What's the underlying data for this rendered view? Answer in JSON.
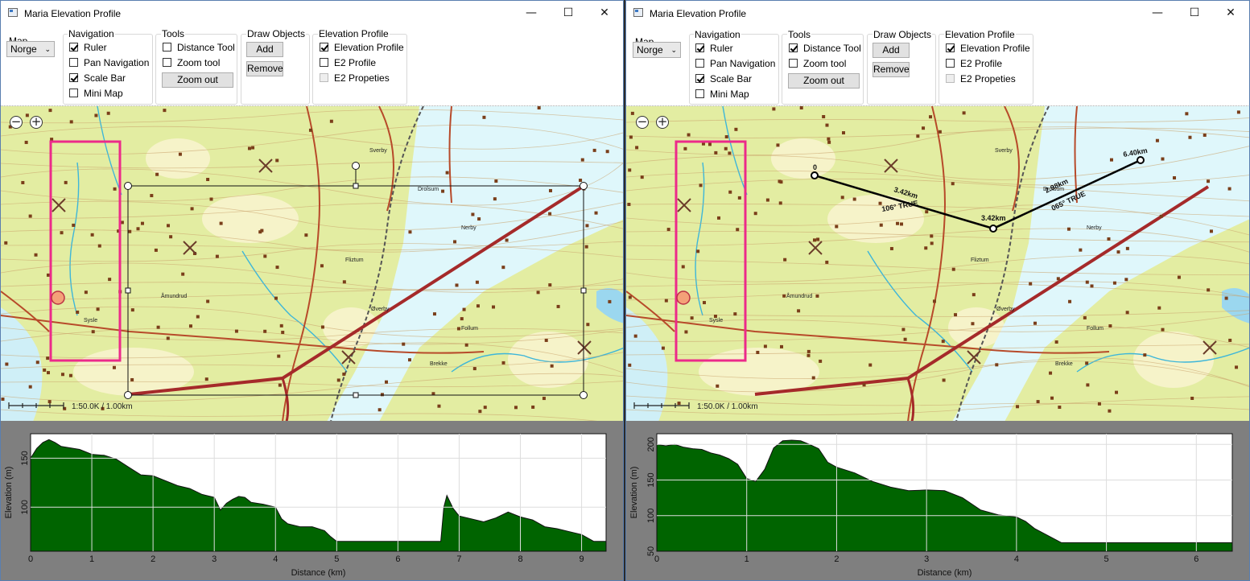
{
  "windows": [
    {
      "title": "Maria Elevation Profile",
      "controls": {
        "minimize": "—",
        "maximize": "☐",
        "close": "✕"
      },
      "toolbar": {
        "map": {
          "label": "Map",
          "selected": "Norge"
        },
        "navigation": {
          "label": "Navigation",
          "items": [
            {
              "label": "Ruler",
              "checked": true
            },
            {
              "label": "Pan Navigation",
              "checked": false
            },
            {
              "label": "Scale Bar",
              "checked": true
            },
            {
              "label": "Mini Map",
              "checked": false
            }
          ]
        },
        "tools": {
          "label": "Tools",
          "items": [
            {
              "label": "Distance Tool",
              "checked": false
            },
            {
              "label": "Zoom tool",
              "checked": false
            }
          ],
          "zoom_out": "Zoom out"
        },
        "draw": {
          "label": "Draw Objects",
          "add": "Add",
          "remove": "Remove"
        },
        "elevation": {
          "label": "Elevation Profile",
          "items": [
            {
              "label": "Elevation Profile",
              "checked": true
            },
            {
              "label": "E2 Profile",
              "checked": false
            },
            {
              "label": "E2 Propeties",
              "checked": false,
              "disabled": true
            }
          ]
        }
      },
      "map": {
        "scale_label": "1:50.0K / 1.00km",
        "zoom_out_symbol": "−",
        "zoom_in_symbol": "+",
        "place_names": [
          "Sysle",
          "Åmundrud",
          "Fliztum",
          "Øverby",
          "Drolsum",
          "Sverby",
          "Nerby",
          "Follum",
          "Brekke"
        ]
      },
      "chart_data": {
        "type": "area",
        "xlabel": "Distance (km)",
        "ylabel": "Elevation (m)",
        "xlim": [
          0,
          9.4
        ],
        "ylim": [
          55,
          175
        ],
        "xticks": [
          "0",
          "1",
          "2",
          "3",
          "4",
          "5",
          "6",
          "7",
          "8",
          "9"
        ],
        "yticks": [
          "100",
          "150"
        ],
        "fill": "#006400",
        "grid": true,
        "x": [
          0,
          0.1,
          0.2,
          0.3,
          0.4,
          0.5,
          0.6,
          0.8,
          1.0,
          1.2,
          1.4,
          1.6,
          1.8,
          2.0,
          2.2,
          2.4,
          2.6,
          2.8,
          3.0,
          3.1,
          3.2,
          3.3,
          3.4,
          3.5,
          3.6,
          3.8,
          4.0,
          4.1,
          4.2,
          4.4,
          4.6,
          4.8,
          4.9,
          5.0,
          5.5,
          6.0,
          6.5,
          6.7,
          6.75,
          6.8,
          6.9,
          7.0,
          7.2,
          7.4,
          7.6,
          7.8,
          8.0,
          8.2,
          8.4,
          8.6,
          8.8,
          9.0,
          9.2,
          9.4
        ],
        "y": [
          150,
          160,
          166,
          169,
          166,
          162,
          161,
          159,
          154,
          153,
          149,
          141,
          133,
          132,
          127,
          122,
          119,
          113,
          110,
          97,
          104,
          108,
          111,
          110,
          105,
          103,
          100,
          88,
          83,
          80,
          80,
          76,
          70,
          65,
          65,
          65,
          65,
          65,
          100,
          112,
          99,
          91,
          88,
          85,
          89,
          95,
          90,
          87,
          80,
          78,
          75,
          72,
          65,
          65
        ]
      }
    },
    {
      "title": "Maria Elevation Profile",
      "controls": {
        "minimize": "—",
        "maximize": "☐",
        "close": "✕"
      },
      "toolbar": {
        "map": {
          "label": "Map",
          "selected": "Norge"
        },
        "navigation": {
          "label": "Navigation",
          "items": [
            {
              "label": "Ruler",
              "checked": true
            },
            {
              "label": "Pan Navigation",
              "checked": false
            },
            {
              "label": "Scale Bar",
              "checked": true
            },
            {
              "label": "Mini Map",
              "checked": false
            }
          ]
        },
        "tools": {
          "label": "Tools",
          "items": [
            {
              "label": "Distance Tool",
              "checked": true
            },
            {
              "label": "Zoom tool",
              "checked": false
            }
          ],
          "zoom_out": "Zoom out"
        },
        "draw": {
          "label": "Draw Objects",
          "add": "Add",
          "remove": "Remove"
        },
        "elevation": {
          "label": "Elevation Profile",
          "items": [
            {
              "label": "Elevation Profile",
              "checked": true
            },
            {
              "label": "E2 Profile",
              "checked": false
            },
            {
              "label": "E2 Propeties",
              "checked": false,
              "disabled": true
            }
          ]
        }
      },
      "map": {
        "scale_label": "1:50.0K / 1.00km",
        "zoom_out_symbol": "−",
        "zoom_in_symbol": "+",
        "place_names": [
          "Sysle",
          "Åmundrud",
          "Fliztum",
          "Øverby",
          "Drolsum",
          "Sverby",
          "Nerby",
          "Follum",
          "Brekke"
        ],
        "distance_tool": {
          "start_label": "0",
          "mid_label": "3.42km",
          "end_label": "6.40km",
          "seg1_length": "3.42km",
          "seg1_bearing": "106° TRUE",
          "seg2_length": "2.98km",
          "seg2_bearing": "065° TRUE"
        }
      },
      "chart_data": {
        "type": "area",
        "xlabel": "Distance (km)",
        "ylabel": "Elevation (m)",
        "xlim": [
          0,
          6.4
        ],
        "ylim": [
          50,
          215
        ],
        "xticks": [
          "0",
          "1",
          "2",
          "3",
          "4",
          "5",
          "6"
        ],
        "yticks": [
          "50",
          "100",
          "150",
          "200"
        ],
        "fill": "#006400",
        "grid": true,
        "x": [
          0,
          0.1,
          0.2,
          0.3,
          0.4,
          0.5,
          0.6,
          0.7,
          0.8,
          0.9,
          1.0,
          1.1,
          1.2,
          1.3,
          1.4,
          1.5,
          1.6,
          1.7,
          1.8,
          1.9,
          2.0,
          2.2,
          2.4,
          2.6,
          2.8,
          3.0,
          3.2,
          3.4,
          3.6,
          3.8,
          4.0,
          4.1,
          4.2,
          4.5,
          5.0,
          5.5,
          6.0,
          6.4
        ],
        "y": [
          200,
          198,
          200,
          196,
          194,
          193,
          188,
          185,
          180,
          172,
          152,
          148,
          165,
          195,
          205,
          206,
          205,
          200,
          194,
          175,
          168,
          160,
          148,
          140,
          135,
          136,
          135,
          125,
          108,
          101,
          98,
          92,
          82,
          62,
          62,
          62,
          62,
          62
        ]
      }
    }
  ]
}
